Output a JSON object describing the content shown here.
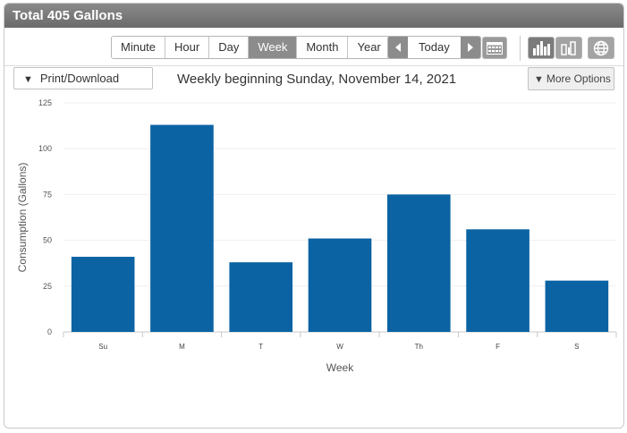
{
  "header": {
    "title": "Total 405 Gallons"
  },
  "time_range": {
    "options": [
      "Minute",
      "Hour",
      "Day",
      "Week",
      "Month",
      "Year"
    ],
    "active": "Week"
  },
  "navigation": {
    "today_label": "Today",
    "prev_icon": "chevron-left-icon",
    "next_icon": "chevron-right-icon",
    "calendar_icon": "calendar-icon"
  },
  "view_icons": [
    "bar-chart-icon",
    "compare-chart-icon",
    "globe-icon"
  ],
  "toolbar": {
    "print_label": "Print/Download",
    "more_label": "More Options"
  },
  "period_label": "Weekly beginning Sunday, November 14, 2021",
  "colors": {
    "bar": "#0b63a3",
    "header": "#7a7a7a",
    "active_button": "#8c8c8c"
  },
  "chart_data": {
    "type": "bar",
    "categories": [
      "Su",
      "M",
      "T",
      "W",
      "Th",
      "F",
      "S"
    ],
    "values": [
      41,
      113,
      38,
      51,
      75,
      56,
      28
    ],
    "xlabel": "Week",
    "ylabel": "Consumption (Gallons)",
    "ylim": [
      0,
      125
    ],
    "yticks": [
      0,
      25,
      50,
      75,
      100,
      125
    ],
    "grid": true
  }
}
